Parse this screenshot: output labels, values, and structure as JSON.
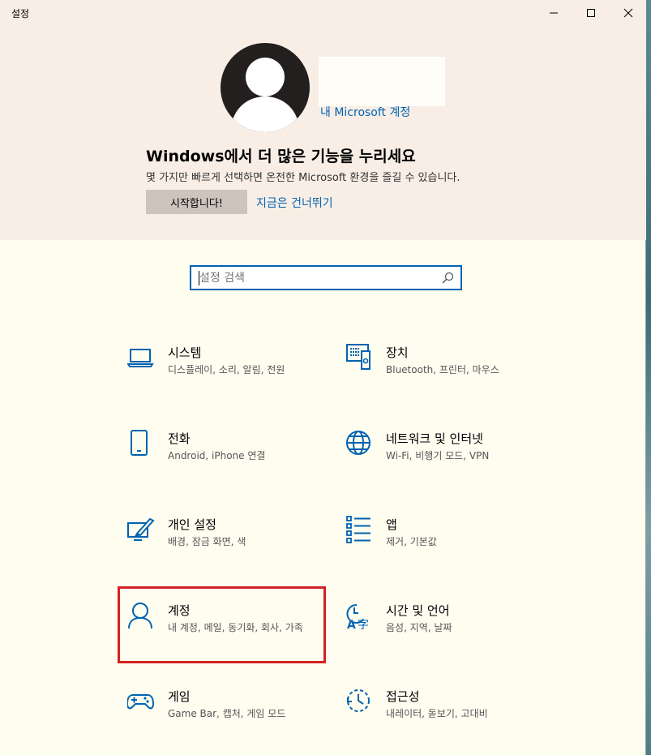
{
  "window": {
    "title": "설정"
  },
  "hero": {
    "ms_link": "내 Microsoft 계정",
    "title": "Windows에서 더 많은 기능을 누리세요",
    "description": "몇 가지만 빠르게 선택하면 온전한 Microsoft 환경을 즐길 수 있습니다.",
    "start_button": "시작합니다!",
    "skip_link": "지금은 건너뛰기"
  },
  "search": {
    "placeholder": "설정 검색",
    "value": ""
  },
  "categories": [
    {
      "name": "시스템",
      "sub": "디스플레이, 소리, 알림, 전원",
      "icon": "laptop-icon"
    },
    {
      "name": "장치",
      "sub": "Bluetooth, 프린터, 마우스",
      "icon": "devices-icon"
    },
    {
      "name": "전화",
      "sub": "Android, iPhone 연결",
      "icon": "phone-icon"
    },
    {
      "name": "네트워크 및 인터넷",
      "sub": "Wi-Fi, 비행기 모드, VPN",
      "icon": "globe-icon"
    },
    {
      "name": "개인 설정",
      "sub": "배경, 잠금 화면, 색",
      "icon": "personalization-icon"
    },
    {
      "name": "앱",
      "sub": "제거, 기본값",
      "icon": "apps-list-icon"
    },
    {
      "name": "계정",
      "sub": "내 계정, 메일, 동기화, 회사, 가족",
      "icon": "person-icon"
    },
    {
      "name": "시간 및 언어",
      "sub": "음성, 지역, 날짜",
      "icon": "time-language-icon"
    },
    {
      "name": "게임",
      "sub": "Game Bar, 캡처, 게임 모드",
      "icon": "gamepad-icon"
    },
    {
      "name": "접근성",
      "sub": "내레이터, 돋보기, 고대비",
      "icon": "accessibility-icon"
    }
  ],
  "colors": {
    "accent": "#0063b1",
    "highlight": "#d42121",
    "hero_bg": "#f8eee6",
    "body_bg": "#fefdf0"
  }
}
